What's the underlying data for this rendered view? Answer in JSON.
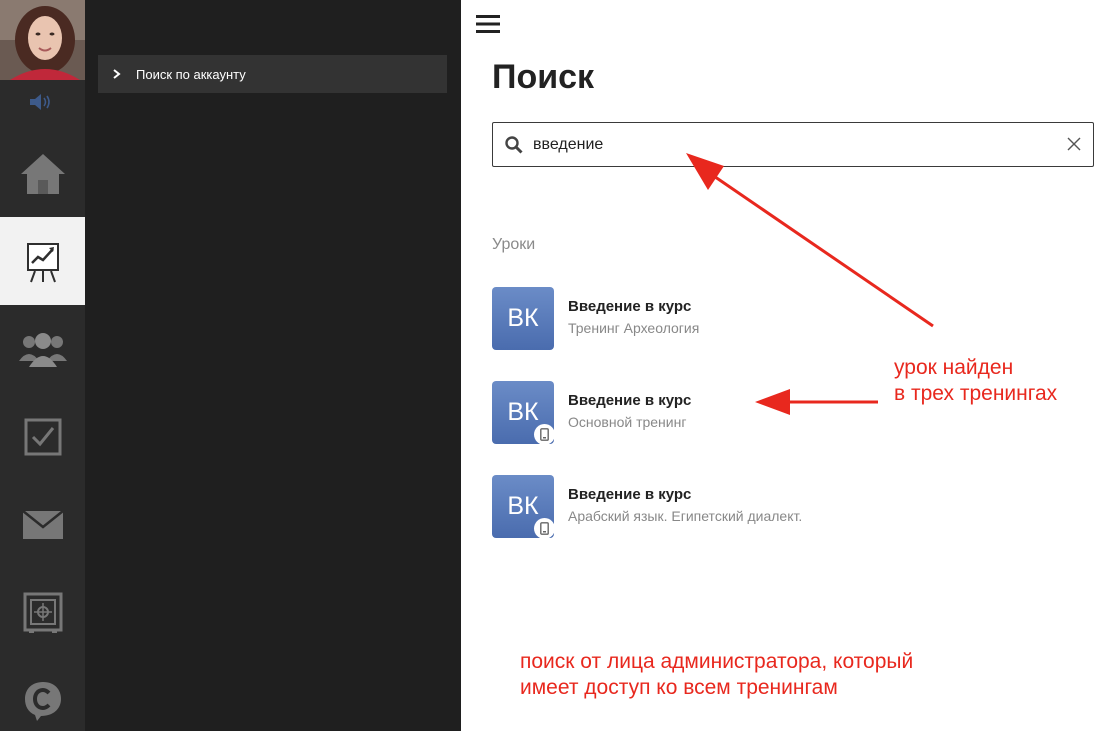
{
  "sidebar": {
    "items": [
      {
        "icon": "home-icon"
      },
      {
        "icon": "presentation-chart-icon",
        "active": true
      },
      {
        "icon": "users-group-icon"
      },
      {
        "icon": "checkbox-icon"
      },
      {
        "icon": "envelope-icon"
      },
      {
        "icon": "safe-icon"
      },
      {
        "icon": "chat-c-icon"
      }
    ]
  },
  "panel": {
    "item_label": "Поиск по аккаунту"
  },
  "main": {
    "title": "Поиск",
    "search": {
      "value": "введение"
    },
    "section_title": "Уроки",
    "results": [
      {
        "badge": "ВК",
        "title": "Введение в курс",
        "subtitle": "Тренинг Археология",
        "mobile": false
      },
      {
        "badge": "ВК",
        "title": "Введение в курс",
        "subtitle": "Основной тренинг",
        "mobile": true
      },
      {
        "badge": "ВК",
        "title": "Введение в курс",
        "subtitle": "Арабский язык. Египетский диалект.",
        "mobile": true
      }
    ]
  },
  "annotations": {
    "found_line1": "урок найден",
    "found_line2": "в трех тренингах",
    "admin_line1": "поиск от лица администратора, который",
    "admin_line2": "имеет доступ ко всем тренингам"
  },
  "colors": {
    "accent_red": "#e8281e",
    "badge_blue": "#5577b8",
    "rail_bg": "#2b2b2b",
    "panel_bg": "#1f1f1f"
  }
}
